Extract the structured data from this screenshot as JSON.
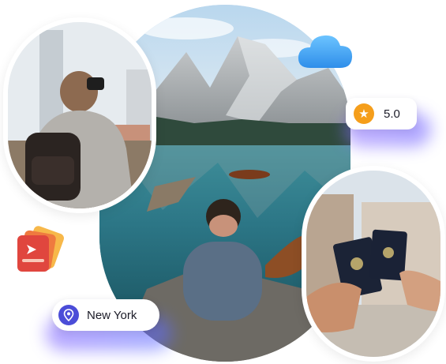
{
  "rating": {
    "value": "5.0"
  },
  "location": {
    "label": "New York"
  },
  "icons": {
    "star": "star-icon",
    "pin": "location-pin-icon",
    "cloud": "cloud-icon",
    "ticket": "plane-ticket-icon"
  },
  "colors": {
    "accent_purple": "#4b4dd8",
    "star_orange": "#f59e1b",
    "glow_purple": "#7a5cff",
    "cloud_blue": "#3aa6ff"
  }
}
